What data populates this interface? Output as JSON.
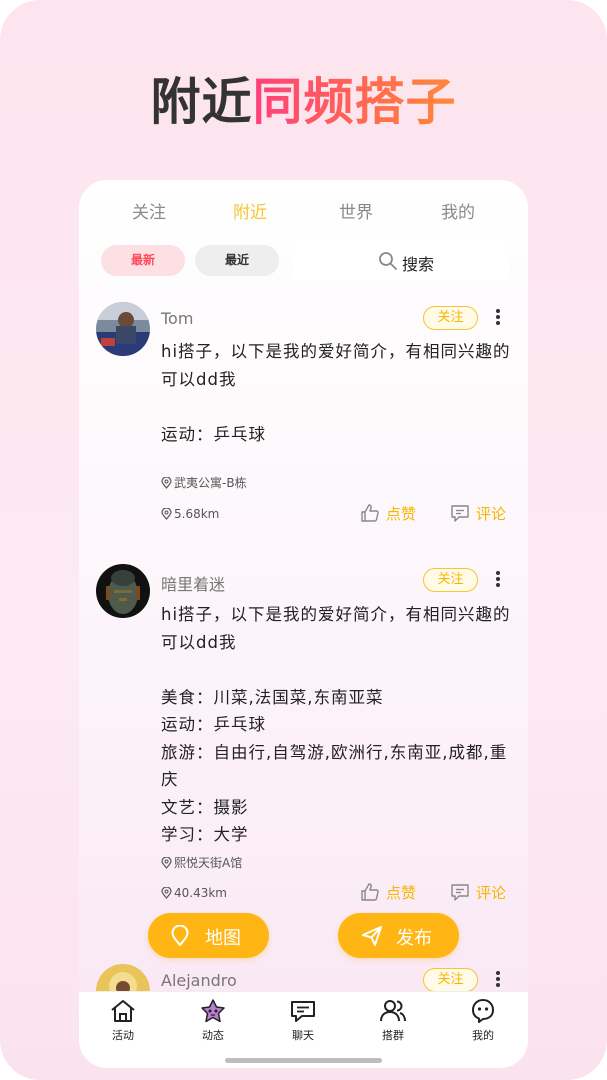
{
  "headline": {
    "part1": "附近",
    "part2": "同频搭子"
  },
  "tabs": [
    {
      "label": "关注",
      "active": false
    },
    {
      "label": "附近",
      "active": true
    },
    {
      "label": "世界",
      "active": false
    },
    {
      "label": "我的",
      "active": false
    }
  ],
  "filters": {
    "latest": "最新",
    "recent": "最近"
  },
  "search": {
    "placeholder": "搜索"
  },
  "colors": {
    "accent": "#f6c531",
    "fab": "#ffb614",
    "latest_pill_text": "#ff4b5c"
  },
  "posts": [
    {
      "name": "Tom",
      "follow": "关注",
      "text": "hi搭子，以下是我的爱好简介，有相同兴趣的可以dd我\n\n运动：乒乓球",
      "location": "武夷公寓-B栋",
      "distance": "5.68km",
      "like": "点赞",
      "comment": "评论"
    },
    {
      "name": "暗里着迷",
      "follow": "关注",
      "text": "hi搭子，以下是我的爱好简介，有相同兴趣的可以dd我\n\n美食：川菜,法国菜,东南亚菜\n运动：乒乓球\n旅游：自由行,自驾游,欧洲行,东南亚,成都,重庆\n文艺：摄影\n学习：大学",
      "location": "熙悦天街A馆",
      "distance": "40.43km",
      "like": "点赞",
      "comment": "评论"
    },
    {
      "name": "Alejandro",
      "follow": "关注"
    }
  ],
  "fab": {
    "map": "地图",
    "publish": "发布"
  },
  "tabbar": [
    {
      "label": "活动",
      "icon": "home-icon"
    },
    {
      "label": "动态",
      "icon": "star-mascot-icon"
    },
    {
      "label": "聊天",
      "icon": "chat-icon"
    },
    {
      "label": "搭群",
      "icon": "group-icon"
    },
    {
      "label": "我的",
      "icon": "face-icon"
    }
  ]
}
